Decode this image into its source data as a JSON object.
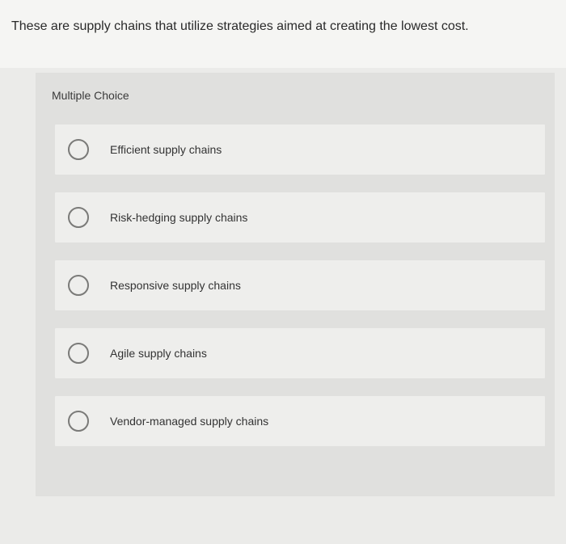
{
  "question": {
    "text": "These are supply chains that utilize strategies aimed at creating the lowest cost."
  },
  "mc": {
    "heading": "Multiple Choice",
    "options": [
      {
        "label": "Efficient supply chains"
      },
      {
        "label": "Risk-hedging supply chains"
      },
      {
        "label": "Responsive supply chains"
      },
      {
        "label": "Agile supply chains"
      },
      {
        "label": "Vendor-managed supply chains"
      }
    ]
  }
}
